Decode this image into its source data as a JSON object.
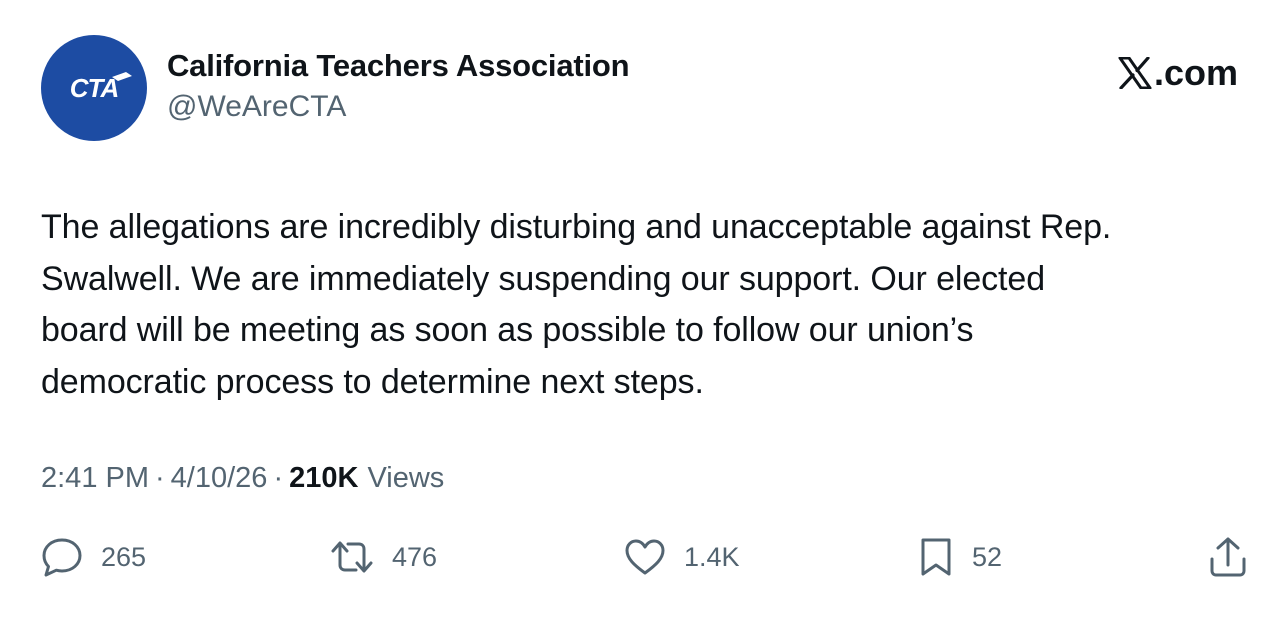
{
  "author": {
    "avatar_text": "CTA",
    "name": "California Teachers Association",
    "handle": "@WeAreCTA"
  },
  "brand": {
    "logo_icon": "x-logo-icon",
    "suffix": ".com"
  },
  "tweet": {
    "text": "The allegations are incredibly disturbing and unacceptable against Rep.\nSwalwell. We are immediately suspending our support. Our elected\nboard will be meeting as soon as possible to follow our union’s\ndemocratic process to determine next steps."
  },
  "meta": {
    "time": "2:41 PM",
    "separator": "·",
    "date": "4/10/26",
    "views_count": "210K",
    "views_label": "Views"
  },
  "actions": {
    "replies": {
      "icon": "reply-icon",
      "count": "265"
    },
    "reposts": {
      "icon": "repost-icon",
      "count": "476"
    },
    "likes": {
      "icon": "heart-icon",
      "count": "1.4K"
    },
    "bookmarks": {
      "icon": "bookmark-icon",
      "count": "52"
    },
    "share": {
      "icon": "share-icon"
    }
  },
  "colors": {
    "avatar_bg": "#1d4ca3",
    "text_primary": "#0f1419",
    "text_secondary": "#536471"
  }
}
